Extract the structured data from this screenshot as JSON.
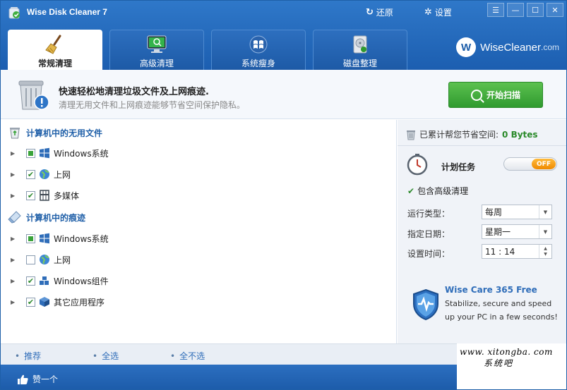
{
  "app": {
    "title": "Wise Disk Cleaner 7",
    "restore_label": "还原",
    "settings_label": "设置",
    "window_buttons": [
      "menu",
      "minimize",
      "maximize",
      "close"
    ]
  },
  "tabs": [
    {
      "label": "常规清理",
      "icon": "broom-icon",
      "active": true
    },
    {
      "label": "高级清理",
      "icon": "monitor-search-icon",
      "active": false
    },
    {
      "label": "系统瘦身",
      "icon": "windows-logo-icon",
      "active": false
    },
    {
      "label": "磁盘整理",
      "icon": "disk-defrag-icon",
      "active": false
    }
  ],
  "brand": {
    "logo_letter": "W",
    "name": "WiseCleaner",
    "suffix": ".com"
  },
  "banner": {
    "title": "快速轻松地清理垃圾文件及上网痕迹.",
    "subtitle": "清理无用文件和上网痕迹能够节省空间保护隐私。",
    "scan_button": "开始扫描"
  },
  "tree": {
    "section1": {
      "title": "计算机中的无用文件",
      "items": [
        {
          "label": "Windows系统",
          "state": "partial",
          "icon": "windows-logo-icon"
        },
        {
          "label": "上网",
          "state": "checked",
          "icon": "globe-icon"
        },
        {
          "label": "多媒体",
          "state": "checked",
          "icon": "media-icon"
        }
      ]
    },
    "section2": {
      "title": "计算机中的痕迹",
      "items": [
        {
          "label": "Windows系统",
          "state": "partial",
          "icon": "windows-logo-icon"
        },
        {
          "label": "上网",
          "state": "unchecked",
          "icon": "globe-icon"
        },
        {
          "label": "Windows组件",
          "state": "checked",
          "icon": "puzzle-icon"
        },
        {
          "label": "其它应用程序",
          "state": "checked",
          "icon": "box-icon"
        }
      ]
    }
  },
  "right": {
    "saved_label": "已累计帮您节省空间:",
    "saved_value": "0 Bytes",
    "schedule_title": "计划任务",
    "toggle_label": "OFF",
    "include_advanced": "包含高级清理",
    "run_type_label": "运行类型：",
    "run_type_value": "每周",
    "date_label": "指定日期：",
    "date_value": "星期一",
    "time_label": "设置时间：",
    "time_value": "11 : 14",
    "promo_title": "Wise Care 365 Free",
    "promo_line1": "Stabilize, secure and speed",
    "promo_line2": "up your PC in a few seconds!"
  },
  "selection": {
    "recommend": "推荐",
    "select_all": "全选",
    "select_none": "全不选"
  },
  "status": {
    "like_label": "赞一个"
  },
  "watermark": {
    "line1": "www. xitongba. com",
    "line2": "系统吧"
  },
  "colors": {
    "header_blue": "#1f5fa8",
    "accent_green": "#2f9a2f",
    "toggle_orange": "#f08a00",
    "link_blue": "#2f6db9"
  }
}
